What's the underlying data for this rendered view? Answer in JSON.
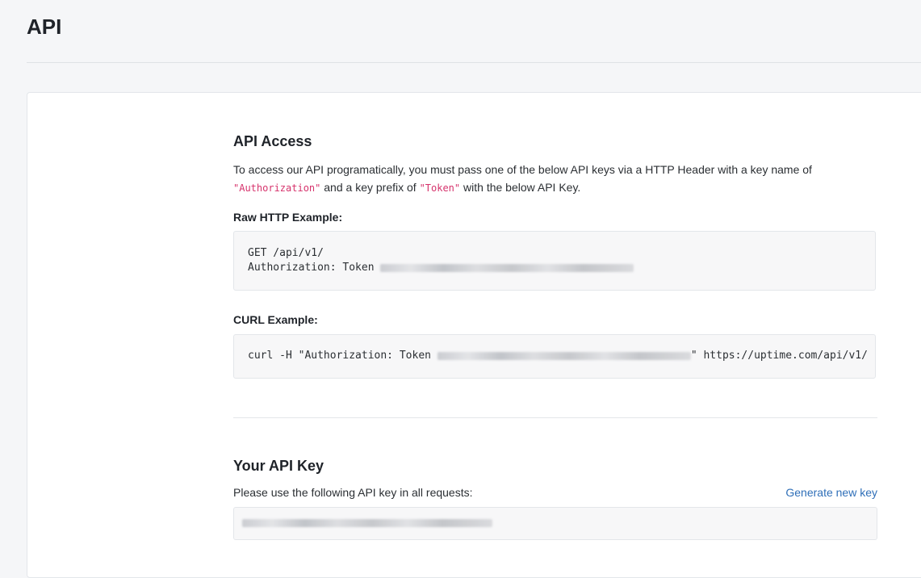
{
  "page": {
    "title": "API"
  },
  "api_access": {
    "title": "API Access",
    "desc_part1": "To access our API programatically, you must pass one of the below API keys via a HTTP Header with a key name of ",
    "header_name": "\"Authorization\"",
    "desc_part2": " and a key prefix of ",
    "prefix": "\"Token\"",
    "desc_part3": " with the below API Key."
  },
  "raw_http": {
    "label": "Raw HTTP Example:",
    "line1": "GET /api/v1/",
    "line2_prefix": "Authorization: Token "
  },
  "curl": {
    "label": "CURL Example:",
    "prefix": "curl -H \"Authorization: Token ",
    "suffix": "\" https://uptime.com/api/v1/"
  },
  "your_key": {
    "title": "Your API Key",
    "prompt": "Please use the following API key in all requests:",
    "generate_label": "Generate new key"
  }
}
